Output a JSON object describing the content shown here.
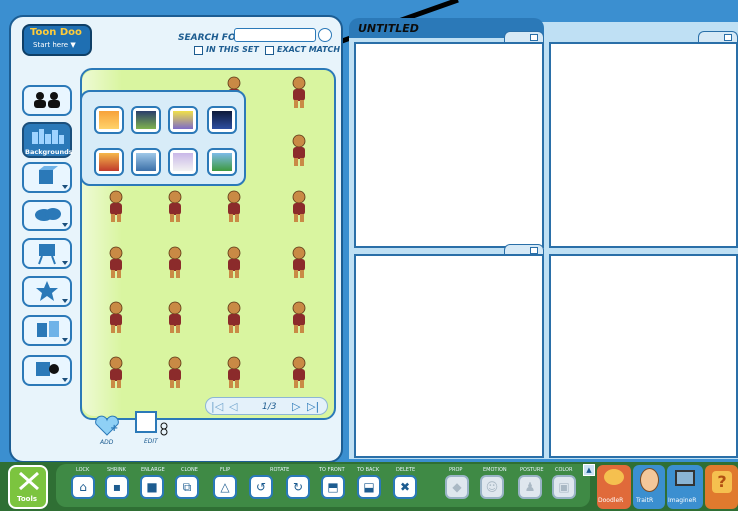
{
  "logo": {
    "brand": "Toon Doo",
    "start_label": "Start here ▼"
  },
  "search": {
    "label": "SEARCH FOR",
    "value": "",
    "opt_in_set": "IN THIS SET",
    "opt_exact": "EXACT MATCH"
  },
  "sidebar": {
    "backgrounds_label": "Backgrounds"
  },
  "pagination": {
    "page": "1/3"
  },
  "library_actions": {
    "add": "ADD",
    "edit": "EDIT"
  },
  "canvas": {
    "title": "UNTITLED"
  },
  "toolbar": {
    "tools_label": "Tools",
    "labels": [
      "LOCK",
      "SHRINK",
      "ENLARGE",
      "CLONE",
      "FLIP",
      "ROTATE",
      "TO FRONT",
      "TO BACK",
      "DELETE",
      "PROP",
      "EMOTION",
      "POSTURE",
      "COLOR"
    ]
  },
  "dock": {
    "doodler": "DoodleR",
    "traitr": "TraitR",
    "imaginer": "ImagineR"
  },
  "colors": {
    "accent": "#2b79b8",
    "library_bg": "#d9f5a0",
    "toolbar_bg": "#3a7a40"
  }
}
